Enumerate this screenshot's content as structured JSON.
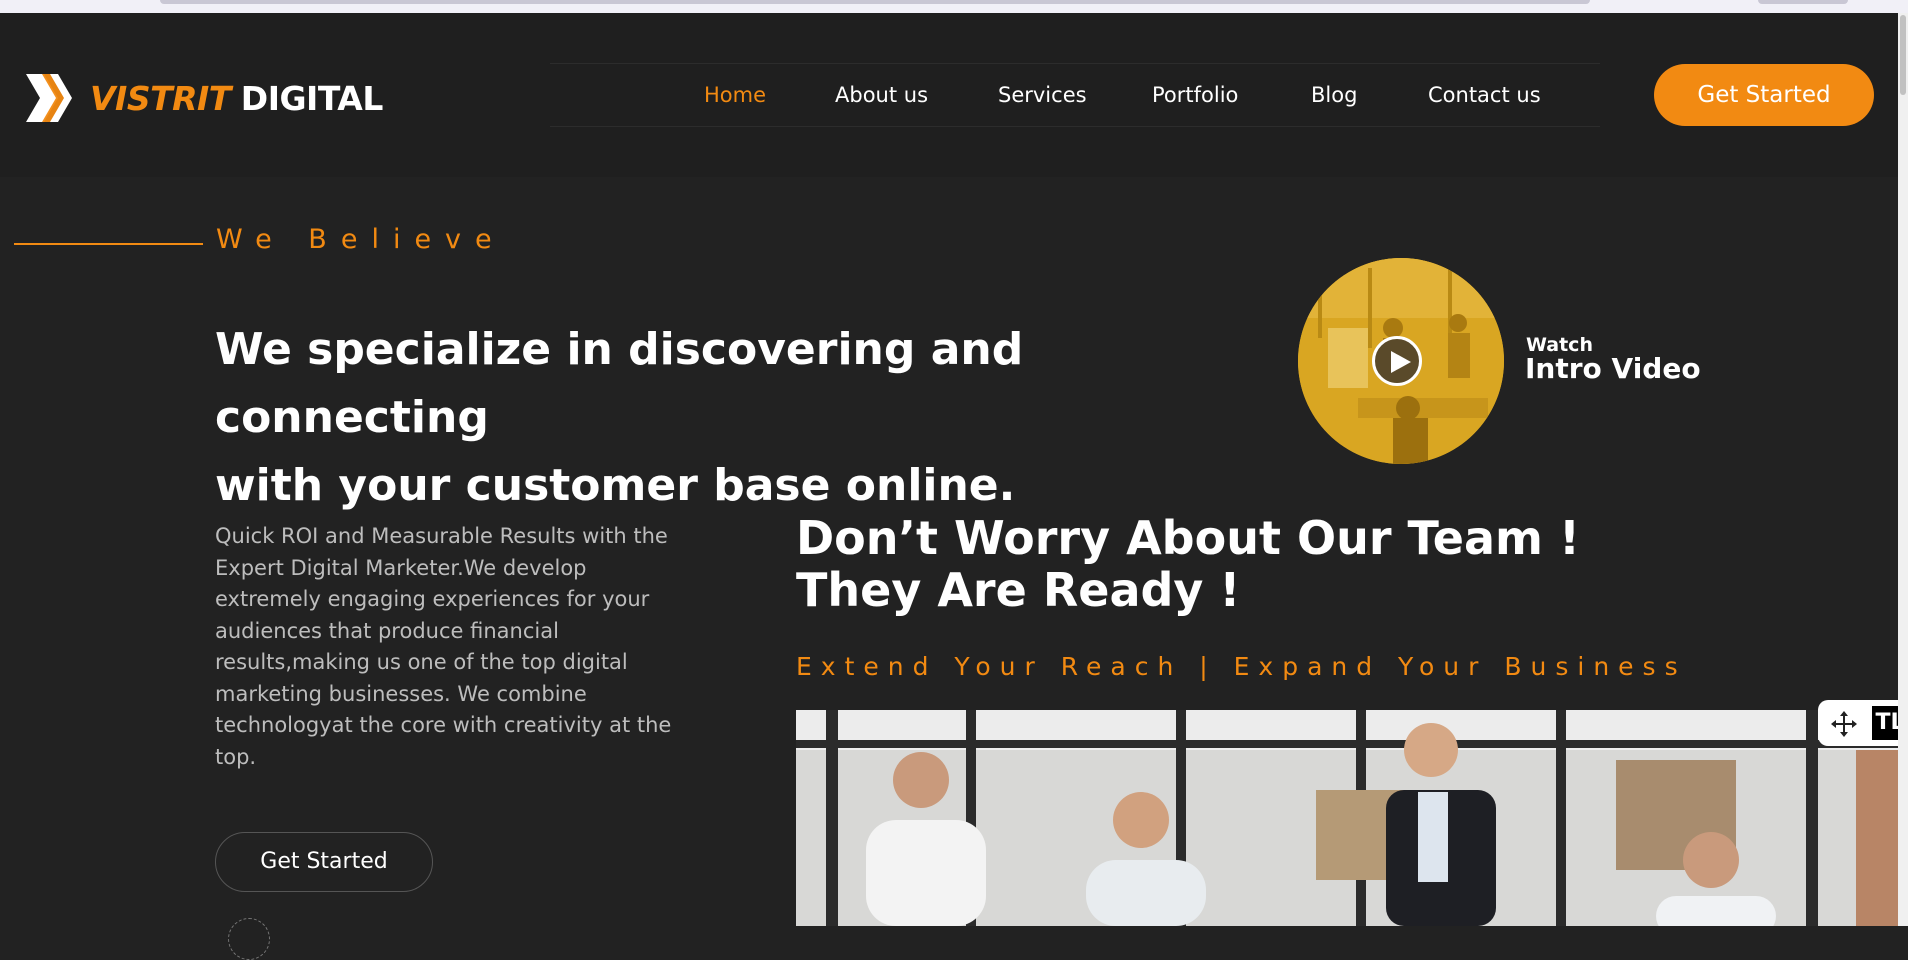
{
  "brand": {
    "word1": "VISTRIT",
    "word2": "DIGITAL"
  },
  "nav": {
    "items": [
      {
        "label": "Home"
      },
      {
        "label": "About us"
      },
      {
        "label": "Services"
      },
      {
        "label": "Portfolio"
      },
      {
        "label": "Blog"
      },
      {
        "label": "Contact us"
      }
    ],
    "active": "Home"
  },
  "header_cta": "Get Started",
  "hero": {
    "kicker": "We Believe",
    "headline_line1": "We specialize in discovering and connecting",
    "headline_line2": "with your customer base online.",
    "video_watch": "Watch",
    "video_title": "Intro Video"
  },
  "intro_paragraph": "Quick ROI and Measurable Results with the Expert Digital Marketer.We develop extremely engaging experiences for your audiences that produce financial results,making us one of the top digital marketing businesses. We combine technologyat the core with creativity at the top.",
  "body_cta": "Get Started",
  "team": {
    "title_line1": "Don’t Worry About Our Team !",
    "title_line2": "They Are Ready !",
    "tagline": "Extend Your Reach | Expand Your Business"
  },
  "float_control": {
    "label": "TL"
  },
  "colors": {
    "accent": "#f28a12",
    "background": "#222222",
    "header": "#1f1f1f"
  },
  "icons": [
    "logo-chevron-icon",
    "play-icon",
    "move-icon"
  ]
}
